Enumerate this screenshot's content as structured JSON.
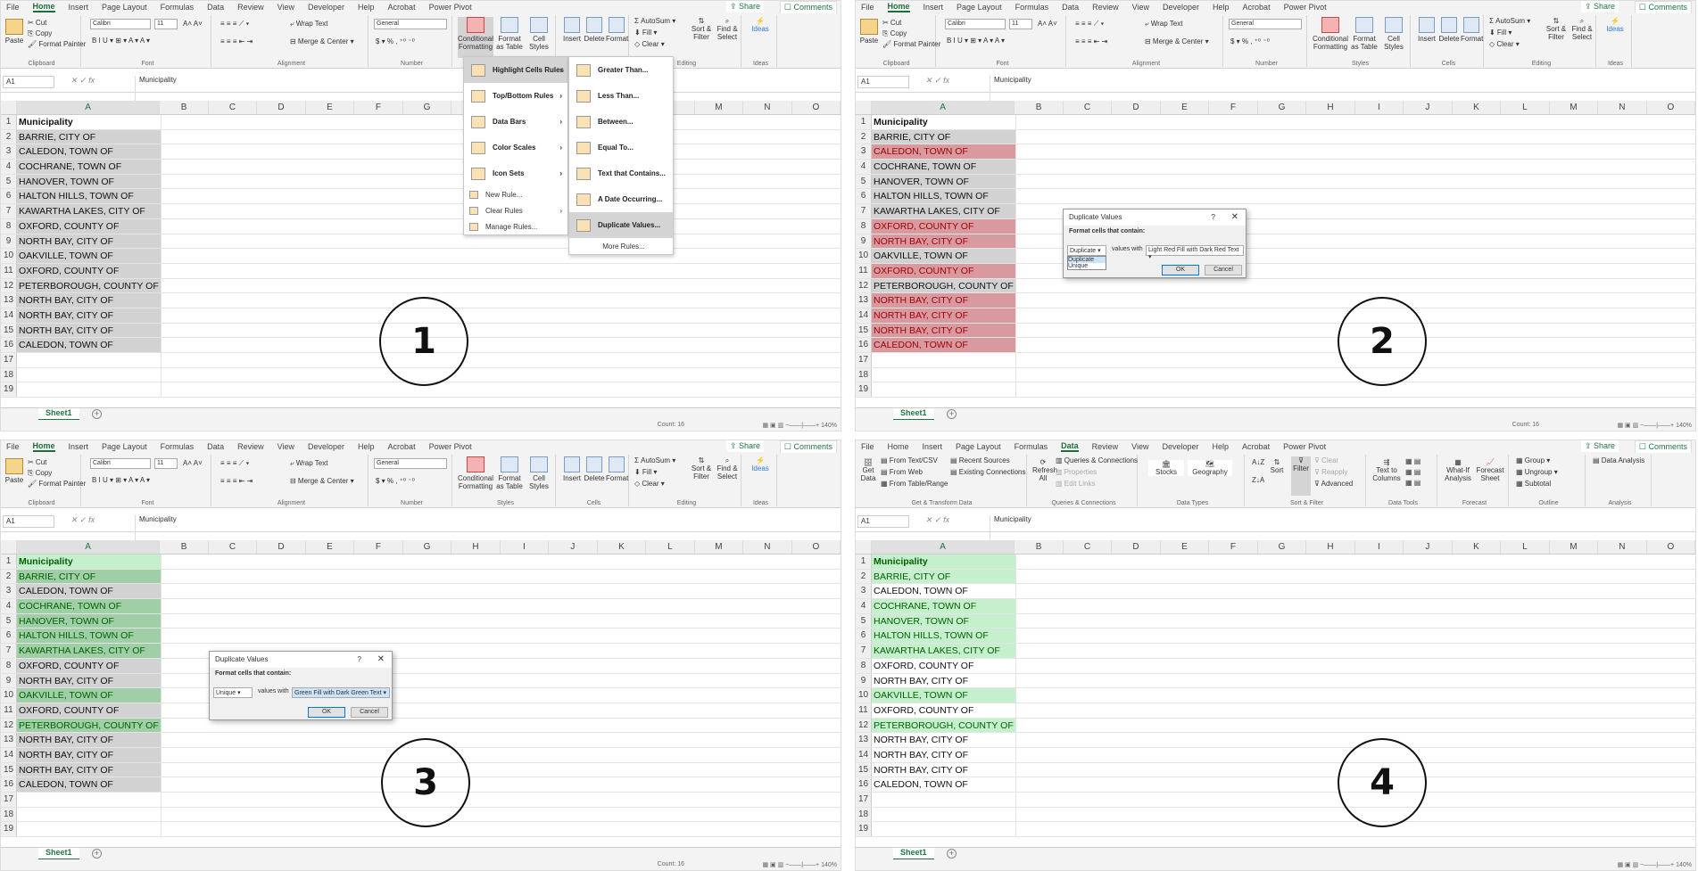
{
  "ribbon_tabs": [
    "File",
    "Home",
    "Insert",
    "Page Layout",
    "Formulas",
    "Data",
    "Review",
    "View",
    "Developer",
    "Help",
    "Acrobat",
    "Power Pivot"
  ],
  "share_label": "Share",
  "comments_label": "Comments",
  "home_ribbon": {
    "clipboard": {
      "paste": "Paste",
      "cut": "Cut",
      "copy": "Copy",
      "format_painter": "Format Painter",
      "label": "Clipboard"
    },
    "font": {
      "name": "Calibri",
      "size": "11",
      "label": "Font"
    },
    "alignment": {
      "wrap": "Wrap Text",
      "merge": "Merge & Center",
      "label": "Alignment"
    },
    "number": {
      "format": "General",
      "label": "Number"
    },
    "styles": {
      "cond": "Conditional Formatting",
      "table": "Format as Table",
      "cell": "Cell Styles",
      "label": "Styles"
    },
    "cells": {
      "insert": "Insert",
      "delete": "Delete",
      "format": "Format",
      "label": "Cells"
    },
    "editing": {
      "autosum": "AutoSum",
      "fill": "Fill",
      "clear": "Clear",
      "sort": "Sort & Filter",
      "find": "Find & Select",
      "label": "Editing"
    },
    "ideas": {
      "ideas": "Ideas",
      "label": "Ideas"
    }
  },
  "data_ribbon": {
    "get": {
      "get_data": "Get Data",
      "text_csv": "From Text/CSV",
      "web": "From Web",
      "table": "From Table/Range",
      "recent": "Recent Sources",
      "existing": "Existing Connections",
      "label": "Get & Transform Data"
    },
    "queries": {
      "refresh": "Refresh All",
      "qc": "Queries & Connections",
      "props": "Properties",
      "links": "Edit Links",
      "label": "Queries & Connections"
    },
    "types": {
      "stocks": "Stocks",
      "geo": "Geography",
      "label": "Data Types"
    },
    "sort": {
      "sort": "Sort",
      "filter": "Filter",
      "clear": "Clear",
      "reapply": "Reapply",
      "advanced": "Advanced",
      "label": "Sort & Filter"
    },
    "tools": {
      "ttc": "Text to Columns",
      "label": "Data Tools"
    },
    "forecast": {
      "whatif": "What-If Analysis",
      "sheet": "Forecast Sheet",
      "label": "Forecast"
    },
    "outline": {
      "group": "Group",
      "ungroup": "Ungroup",
      "subtotal": "Subtotal",
      "label": "Outline"
    },
    "analysis": {
      "da": "Data Analysis",
      "label": "Analysis"
    }
  },
  "name_box": "A1",
  "formula_value": "Municipality",
  "columns": [
    "A",
    "B",
    "C",
    "D",
    "E",
    "F",
    "G",
    "H",
    "I",
    "J",
    "K",
    "L",
    "M",
    "N",
    "O"
  ],
  "rows": [
    {
      "n": "1",
      "v": "Municipality"
    },
    {
      "n": "2",
      "v": "BARRIE, CITY OF"
    },
    {
      "n": "3",
      "v": "CALEDON, TOWN OF"
    },
    {
      "n": "4",
      "v": "COCHRANE, TOWN OF"
    },
    {
      "n": "5",
      "v": "HANOVER, TOWN OF"
    },
    {
      "n": "6",
      "v": "HALTON HILLS, TOWN OF"
    },
    {
      "n": "7",
      "v": "KAWARTHA LAKES, CITY OF"
    },
    {
      "n": "8",
      "v": "OXFORD, COUNTY OF"
    },
    {
      "n": "9",
      "v": "NORTH BAY, CITY OF"
    },
    {
      "n": "10",
      "v": "OAKVILLE, TOWN OF"
    },
    {
      "n": "11",
      "v": "OXFORD, COUNTY OF"
    },
    {
      "n": "12",
      "v": "PETERBOROUGH, COUNTY OF"
    },
    {
      "n": "13",
      "v": "NORTH BAY, CITY OF"
    },
    {
      "n": "14",
      "v": "NORTH BAY, CITY OF"
    },
    {
      "n": "15",
      "v": "NORTH BAY, CITY OF"
    },
    {
      "n": "16",
      "v": "CALEDON, TOWN OF"
    },
    {
      "n": "17",
      "v": ""
    },
    {
      "n": "18",
      "v": ""
    },
    {
      "n": "19",
      "v": ""
    }
  ],
  "duplicate_rows": [
    3,
    8,
    9,
    11,
    13,
    14,
    15,
    16
  ],
  "unique_rows": [
    1,
    2,
    4,
    5,
    6,
    7,
    10,
    12
  ],
  "sheet_tab": "Sheet1",
  "status": {
    "count": "Count: 16",
    "zoom": "140%"
  },
  "cf_menu": {
    "items": [
      "Highlight Cells Rules",
      "Top/Bottom Rules",
      "Data Bars",
      "Color Scales",
      "Icon Sets"
    ],
    "small": [
      "New Rule...",
      "Clear Rules",
      "Manage Rules..."
    ],
    "sub": [
      "Greater Than...",
      "Less Than...",
      "Between...",
      "Equal To...",
      "Text that Contains...",
      "A Date Occurring...",
      "Duplicate Values..."
    ],
    "more": "More Rules..."
  },
  "dialog2": {
    "title": "Duplicate Values",
    "help": "?",
    "close": "✕",
    "label": "Format cells that contain:",
    "type": "Duplicate",
    "values_with": "values with",
    "format": "Light Red Fill with Dark Red Text",
    "options": [
      "Duplicate",
      "Unique"
    ],
    "ok": "OK",
    "cancel": "Cancel"
  },
  "dialog3": {
    "title": "Duplicate Values",
    "help": "?",
    "close": "✕",
    "label": "Format cells that contain:",
    "type": "Unique",
    "values_with": "values with",
    "format": "Green Fill with Dark Green Text",
    "ok": "OK",
    "cancel": "Cancel"
  },
  "steps": [
    "1",
    "2",
    "3",
    "4"
  ],
  "colors": {
    "accent": "#217346",
    "dup_fill": "#ffc7ce",
    "dup_text": "#9c0006",
    "uniq_fill": "#c6efce",
    "uniq_text": "#006100"
  }
}
